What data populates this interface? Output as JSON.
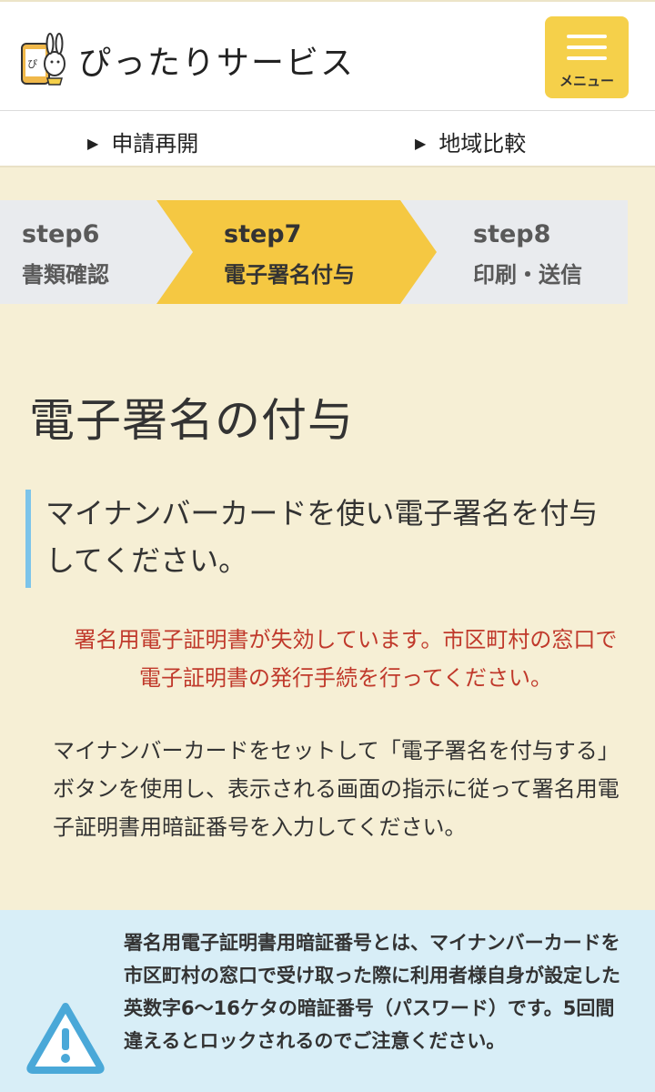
{
  "header": {
    "brand": "ぴったりサービス",
    "menu_label": "メニュー"
  },
  "subnav": [
    {
      "label": "申請再開"
    },
    {
      "label": "地域比較"
    }
  ],
  "steps": [
    {
      "num": "step6",
      "name": "書類確認",
      "state": "done"
    },
    {
      "num": "step7",
      "name": "電子署名付与",
      "state": "current"
    },
    {
      "num": "step8",
      "name": "印刷・送信",
      "state": "todo"
    }
  ],
  "main": {
    "title": "電子署名の付与",
    "lead": "マイナンバーカードを使い電子署名を付与してください。",
    "error": "署名用電子証明書が失効しています。市区町村の窓口で電子証明書の発行手続を行ってください。",
    "description": "マイナンバーカードをセットして「電子署名を付与する」ボタンを使用し、表示される画面の指示に従って署名用電子証明書用暗証番号を入力してください。"
  },
  "notice": {
    "text": "署名用電子証明書用暗証番号とは、マイナンバーカードを市区町村の窓口で受け取った際に利用者様自身が設定した英数字6〜16ケタの暗証番号（パスワード）です。5回間違えるとロックされるのでご注意ください。"
  },
  "colors": {
    "background": "#f6efd5",
    "accent": "#f5d04a",
    "error": "#c0392b",
    "notice_bg": "#d8eef7",
    "lead_border": "#7cc4ea"
  }
}
